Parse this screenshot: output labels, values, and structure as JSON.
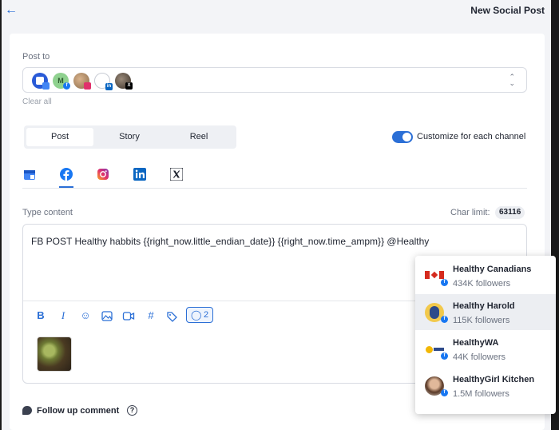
{
  "header": {
    "back_icon": "arrow-left-icon",
    "title": "New Social Post"
  },
  "post_to": {
    "label": "Post to",
    "clear_label": "Clear all",
    "accounts": [
      {
        "name": "account-google",
        "initial": "",
        "badge": "google-business"
      },
      {
        "name": "account-facebook",
        "initial": "M",
        "badge": "facebook"
      },
      {
        "name": "account-instagram",
        "initial": "",
        "badge": "instagram"
      },
      {
        "name": "account-linkedin",
        "initial": "",
        "badge": "linkedin"
      },
      {
        "name": "account-x",
        "initial": "",
        "badge": "x"
      }
    ]
  },
  "post_types": {
    "post": "Post",
    "story": "Story",
    "reel": "Reel",
    "active": "Post"
  },
  "customize": {
    "label": "Customize for each channel",
    "enabled": true
  },
  "channels": [
    "google-business-icon",
    "facebook-icon",
    "instagram-icon",
    "linkedin-icon",
    "x-icon"
  ],
  "content": {
    "label": "Type content",
    "char_limit_label": "Char limit:",
    "char_limit_value": "63116",
    "text": "FB POST Healthy habbits  {{right_now.little_endian_date}} {{right_now.time_ampm}} @Healthy",
    "mention_count": "2"
  },
  "toolbar": [
    "bold-icon",
    "italic-icon",
    "emoji-icon",
    "image-icon",
    "video-icon",
    "hashtag-icon",
    "tag-icon",
    "mention-icon"
  ],
  "follow_up": {
    "label": "Follow up comment",
    "help": "?"
  },
  "mention_suggestions": [
    {
      "name": "Healthy Canadians",
      "followers": "434K followers",
      "logo": "canada-flag"
    },
    {
      "name": "Healthy Harold",
      "followers": "115K followers",
      "logo": "harold-mascot"
    },
    {
      "name": "HealthyWA",
      "followers": "44K followers",
      "logo": "healthywa"
    },
    {
      "name": "HealthyGirl Kitchen",
      "followers": "1.5M followers",
      "logo": "person-photo"
    }
  ],
  "colors": {
    "accent": "#2b6fd6",
    "facebook": "#1877f2"
  }
}
